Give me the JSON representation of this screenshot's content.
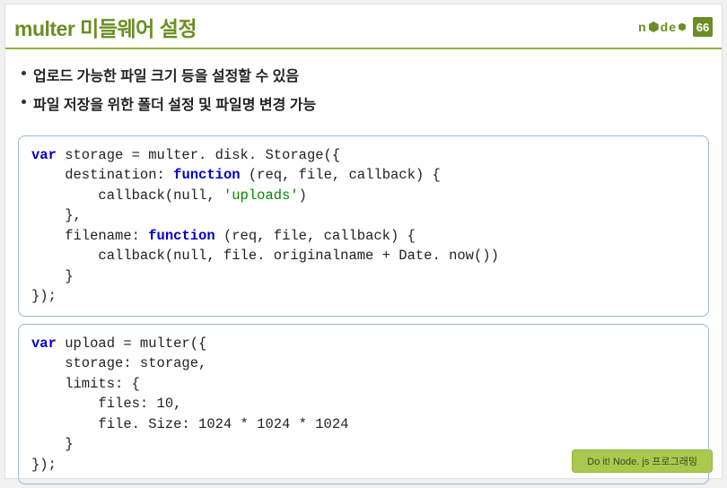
{
  "header": {
    "title": "multer 미들웨어 설정",
    "logo_text": "node",
    "page_number": "66"
  },
  "bullets": [
    "업로드 가능한 파일 크기 등을 설정할 수 있음",
    "파일 저장을 위한 폴더 설정 및 파일명 변경 가능"
  ],
  "code1": {
    "l1a": "var",
    "l1b": " storage = multer. disk. Storage({",
    "l2": "    destination: ",
    "l2k": "function",
    "l2b": " (req, file, callback) {",
    "l3a": "        callback(null, ",
    "l3s": "'uploads'",
    "l3b": ")",
    "l4": "    },",
    "l5": "    filename: ",
    "l5k": "function",
    "l5b": " (req, file, callback) {",
    "l6": "        callback(null, file. originalname + Date. now())",
    "l7": "    }",
    "l8": "});"
  },
  "code2": {
    "l1a": "var",
    "l1b": " upload = multer({",
    "l2": "    storage: storage,",
    "l3": "    limits: {",
    "l4": "        files: 10,",
    "l5": "        file. Size: 1024 * 1024 * 1024",
    "l6": "    }",
    "l7": "});"
  },
  "footer": {
    "label": "Do it! Node. js 프로그래밍"
  }
}
